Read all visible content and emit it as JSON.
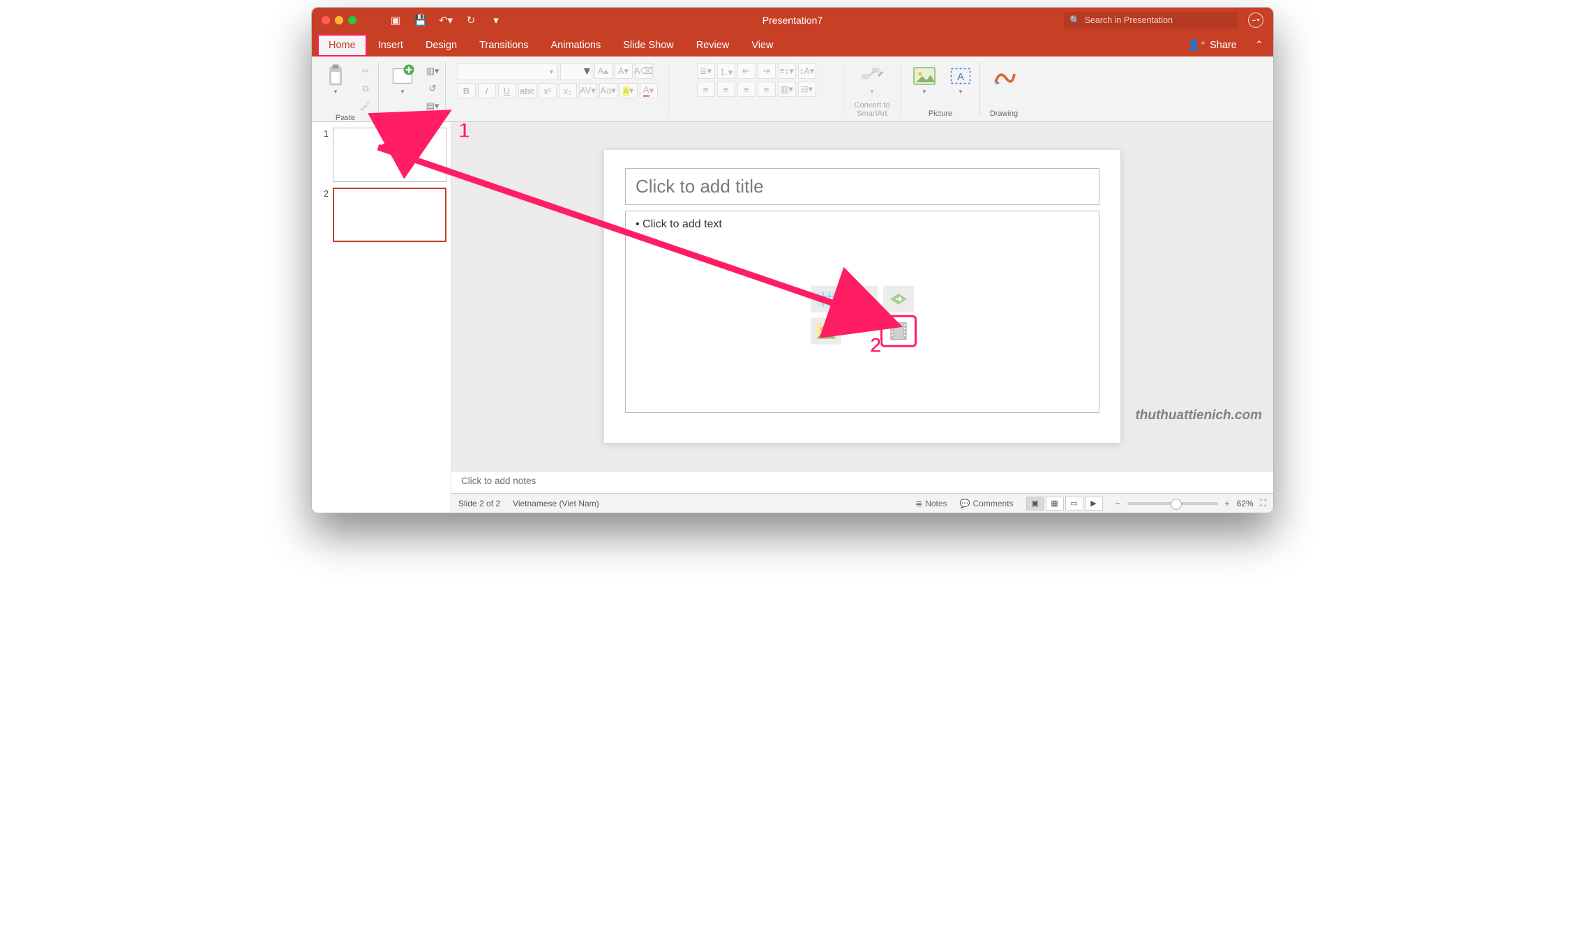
{
  "title": "Presentation7",
  "search_placeholder": "Search in Presentation",
  "tabs": {
    "home": "Home",
    "insert": "Insert",
    "design": "Design",
    "transitions": "Transitions",
    "animations": "Animations",
    "slideshow": "Slide Show",
    "review": "Review",
    "view": "View"
  },
  "share_label": "Share",
  "ribbon": {
    "paste": "Paste",
    "new_slide": "New Slide",
    "convert": "Convert to SmartArt",
    "picture": "Picture",
    "drawing": "Drawing"
  },
  "thumbs": {
    "n1": "1",
    "n2": "2"
  },
  "slide": {
    "title_placeholder": "Click to add title",
    "body_placeholder": "• Click to add text"
  },
  "notes_placeholder": "Click to add notes",
  "watermark": "thuthuattienich.com",
  "status": {
    "slide_counter": "Slide 2 of 2",
    "language": "Vietnamese (Viet Nam)",
    "notes_btn": "Notes",
    "comments_btn": "Comments",
    "zoom_pct": "62%"
  },
  "annotations": {
    "one": "1",
    "two": "2"
  }
}
